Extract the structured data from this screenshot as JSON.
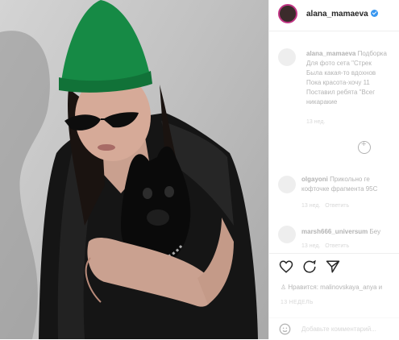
{
  "post": {
    "username": "alana_mamaeva",
    "verified": true
  },
  "caption": {
    "username": "alana_mamaeva",
    "lines": [
      "Подборка",
      "Для фото сета \"Стрек",
      "Была какая-то вдохнов",
      "Пока красота-хочу 11",
      "Поставил ребята \"Всег",
      "никаракие"
    ],
    "time": "13 нед."
  },
  "comments": [
    {
      "username": "olgayoni",
      "text": "Прикольно ге",
      "text2": "кофточке фрагмента 95С",
      "time": "13 нед.",
      "action": "Ответить"
    },
    {
      "username": "marsh666_universum",
      "text": "Беу",
      "time": "13 нед.",
      "action": "Ответить"
    }
  ],
  "likes": {
    "text": "Нравится: malinovskaya_anya и"
  },
  "post_time": "13 НЕДЕЛЬ",
  "add_comment": {
    "placeholder": "Добавьте комментарий..."
  },
  "colors": {
    "hat": "#168a45",
    "accent": "#3897f0",
    "story_ring": "#c13584"
  }
}
